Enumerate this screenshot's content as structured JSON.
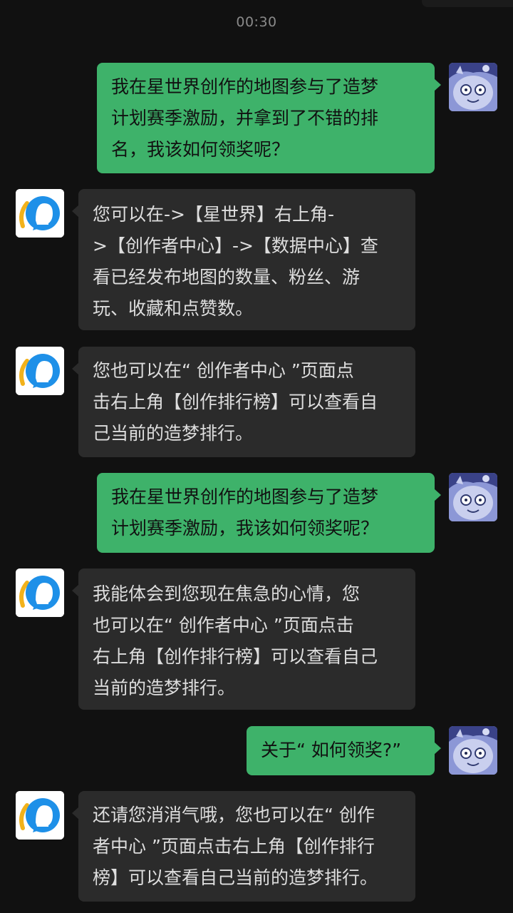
{
  "status": {
    "time": "00:30"
  },
  "messages": [
    {
      "sender": "user",
      "avatar_icon": "cat-avatar-icon",
      "text": "我在星世界创作的地图参与了造梦\n计划赛季激励，并拿到了不错的排\n名，我该如何领奖呢？"
    },
    {
      "sender": "bot",
      "avatar_icon": "assistant-avatar-icon",
      "text": "您可以在->【星世界】右上角-\n>【创作者中心】->【数据中心】查\n看已经发布地图的数量、粉丝、游\n玩、收藏和点赞数。"
    },
    {
      "sender": "bot",
      "avatar_icon": "assistant-avatar-icon",
      "text": "您也可以在“ 创作者中心 ”页面点\n击右上角【创作排行榜】可以查看自\n己当前的造梦排行。"
    },
    {
      "sender": "user",
      "avatar_icon": "cat-avatar-icon",
      "text": "我在星世界创作的地图参与了造梦\n计划赛季激励，我该如何领奖呢？"
    },
    {
      "sender": "bot",
      "avatar_icon": "assistant-avatar-icon",
      "text": "我能体会到您现在焦急的心情，您\n也可以在“ 创作者中心 ”页面点击\n右上角【创作排行榜】可以查看自己\n当前的造梦排行。"
    },
    {
      "sender": "user",
      "avatar_icon": "cat-avatar-icon",
      "text": "关于“ 如何领奖?”"
    },
    {
      "sender": "bot",
      "avatar_icon": "assistant-avatar-icon",
      "text": "还请您消消气哦，您也可以在“ 创作\n者中心 ”页面点击右上角【创作排行\n榜】可以查看自己当前的造梦排行。"
    }
  ],
  "colors": {
    "background": "#111111",
    "user_bubble": "#3eb26a",
    "bot_bubble": "#2b2b2b",
    "timestamp": "#8a8a8a"
  }
}
